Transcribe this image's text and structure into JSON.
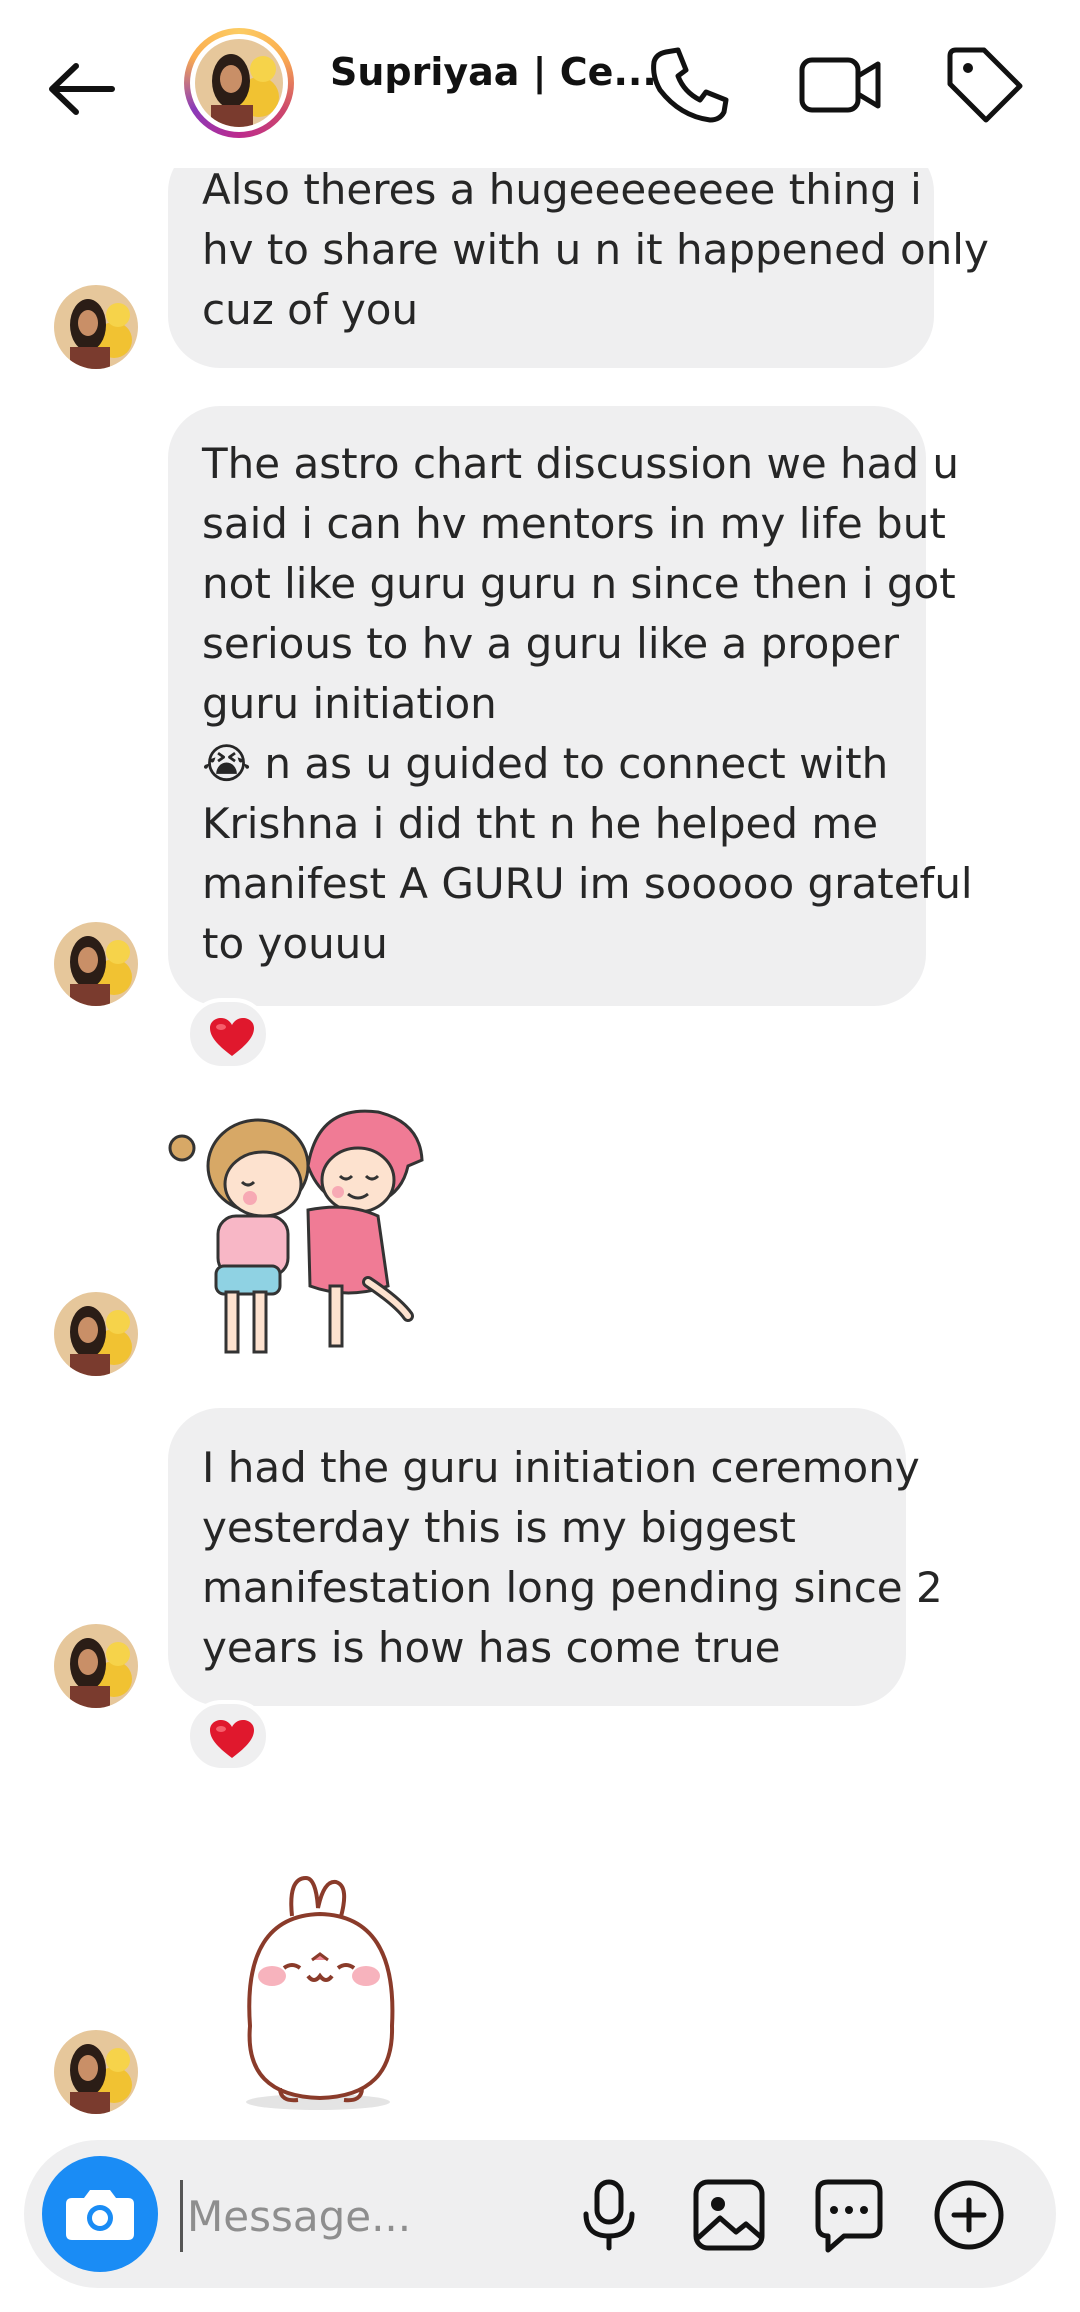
{
  "header": {
    "contact_name": "Supriyaa | Ce..."
  },
  "messages": {
    "m1": {
      "lines": [
        "Also theres a hugeeeeeeee thing i",
        "hv to share with u n it happened only",
        "cuz of you"
      ]
    },
    "m2": {
      "lines": [
        "The astro chart discussion we had u",
        "said i can hv mentors in my life but",
        "not like guru guru n since then i got",
        "serious to hv a guru like a proper",
        "guru initiation",
        "😭 n as u guided to connect with",
        "Krishna i did tht n he helped me",
        "manifest A GURU im sooooo grateful",
        "to youuu"
      ],
      "reaction": "heart"
    },
    "m3": {
      "lines": [
        "I had the guru initiation ceremony",
        "yesterday this is my biggest",
        "manifestation long pending since 2",
        "years is how has come true"
      ],
      "reaction": "heart"
    }
  },
  "composer": {
    "placeholder": "Message..."
  },
  "colors": {
    "bubble": "#efeff0",
    "camera": "#1a8cf5",
    "heart": "#e0182d"
  },
  "icons": [
    "back-arrow-icon",
    "phone-icon",
    "video-camera-icon",
    "tag-icon",
    "camera-icon",
    "microphone-icon",
    "gallery-icon",
    "sticker-icon",
    "add-icon"
  ]
}
